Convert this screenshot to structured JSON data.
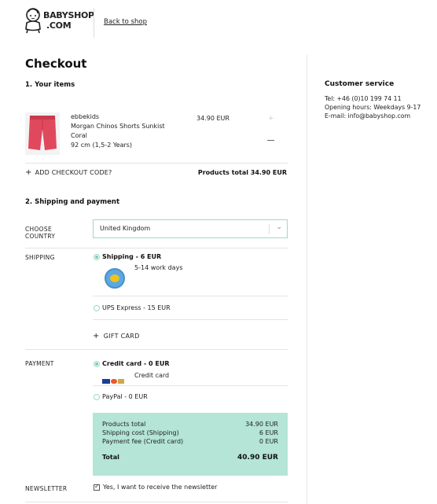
{
  "header": {
    "logo_line1": "BABYSHOP",
    "logo_line2": ".COM",
    "back_link": "Back to shop"
  },
  "page_title": "Checkout",
  "items_section": {
    "title": "1. Your items",
    "item": {
      "brand": "ebbekids",
      "name_line1": "Morgan Chinos Shorts Sunkist",
      "name_line2": "Coral",
      "size": "92 cm (1,5-2 Years)",
      "price": "34.90 EUR",
      "qty_plus": "+",
      "qty_minus": "–",
      "image_color": "#e0495d"
    },
    "checkout_code_label": "ADD CHECKOUT CODE?",
    "products_total": "Products total 34.90 EUR"
  },
  "shipping_section": {
    "title": "2. Shipping and payment",
    "country_label_line1": "CHOOSE",
    "country_label_line2": "COUNTRY",
    "country_value": "United Kingdom",
    "shipping_label": "SHIPPING",
    "shipping_options": [
      {
        "label": "Shipping - 6 EUR",
        "detail": "5-14 work days",
        "selected": true
      },
      {
        "label": "UPS Express - 15 EUR",
        "selected": false
      }
    ],
    "gift_card_label": "GIFT CARD",
    "payment_label": "PAYMENT",
    "payment_options": [
      {
        "label": "Credit card - 0 EUR",
        "detail": "Credit card",
        "selected": true
      },
      {
        "label": "PayPal - 0 EUR",
        "selected": false
      }
    ]
  },
  "summary": {
    "rows": [
      {
        "label": "Products total",
        "value": "34.90 EUR"
      },
      {
        "label": "Shipping cost (Shipping)",
        "value": "6 EUR"
      },
      {
        "label": "Payment fee (Credit card)",
        "value": "0 EUR"
      }
    ],
    "total_label": "Total",
    "total_value": "40.90 EUR",
    "background": "#b4e5d7"
  },
  "newsletter": {
    "label": "NEWSLETTER",
    "text": "Yes, I want to receive the newsletter",
    "checked": true
  },
  "customer_service": {
    "title": "Customer service",
    "phone": "Tel: +46 (0)10 199 74 11",
    "hours": "Opening hours: Weekdays 9-17",
    "email": "E-mail: info@babyshop.com"
  },
  "icons": {
    "plus": "plus-icon",
    "chevron": "chevron-down-icon",
    "check": "check-icon",
    "post_horn": "post-horn-icon",
    "card_logos": "card-logos-icon"
  },
  "colors": {
    "accent": "#9fd9c8",
    "radio_fill": "#7fc9b5"
  }
}
